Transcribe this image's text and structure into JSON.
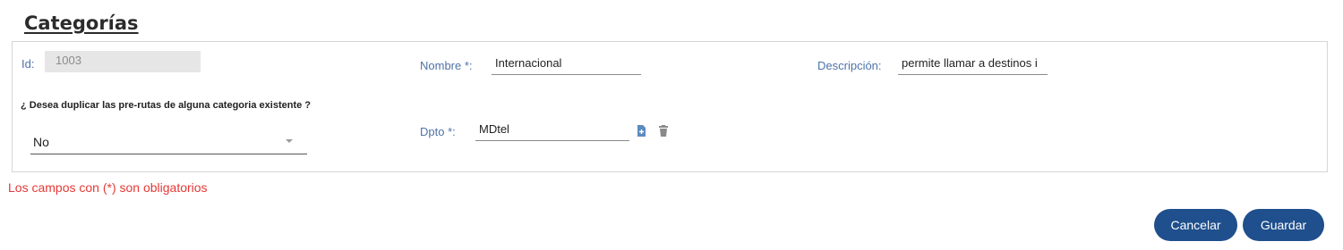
{
  "page": {
    "title": "Categorías"
  },
  "form": {
    "id_label": "Id:",
    "id_value": "1003",
    "nombre_label": "Nombre *:",
    "nombre_value": "Internacional",
    "descripcion_label": "Descripción:",
    "descripcion_value": "permite llamar a destinos i",
    "duplicate_question": "¿ Desea duplicar las pre-rutas de alguna categoria existente ?",
    "duplicate_selected": "No",
    "dpto_label": "Dpto *:",
    "dpto_value": "MDtel"
  },
  "required_note": "Los campos con (*) son obligatorios",
  "buttons": {
    "cancel": "Cancelar",
    "save": "Guardar"
  },
  "colors": {
    "accent": "#1f4f8c",
    "label": "#4f73a8",
    "error": "#e53935"
  },
  "icons": [
    "add-file-icon",
    "trash-icon",
    "chevron-down-icon"
  ]
}
